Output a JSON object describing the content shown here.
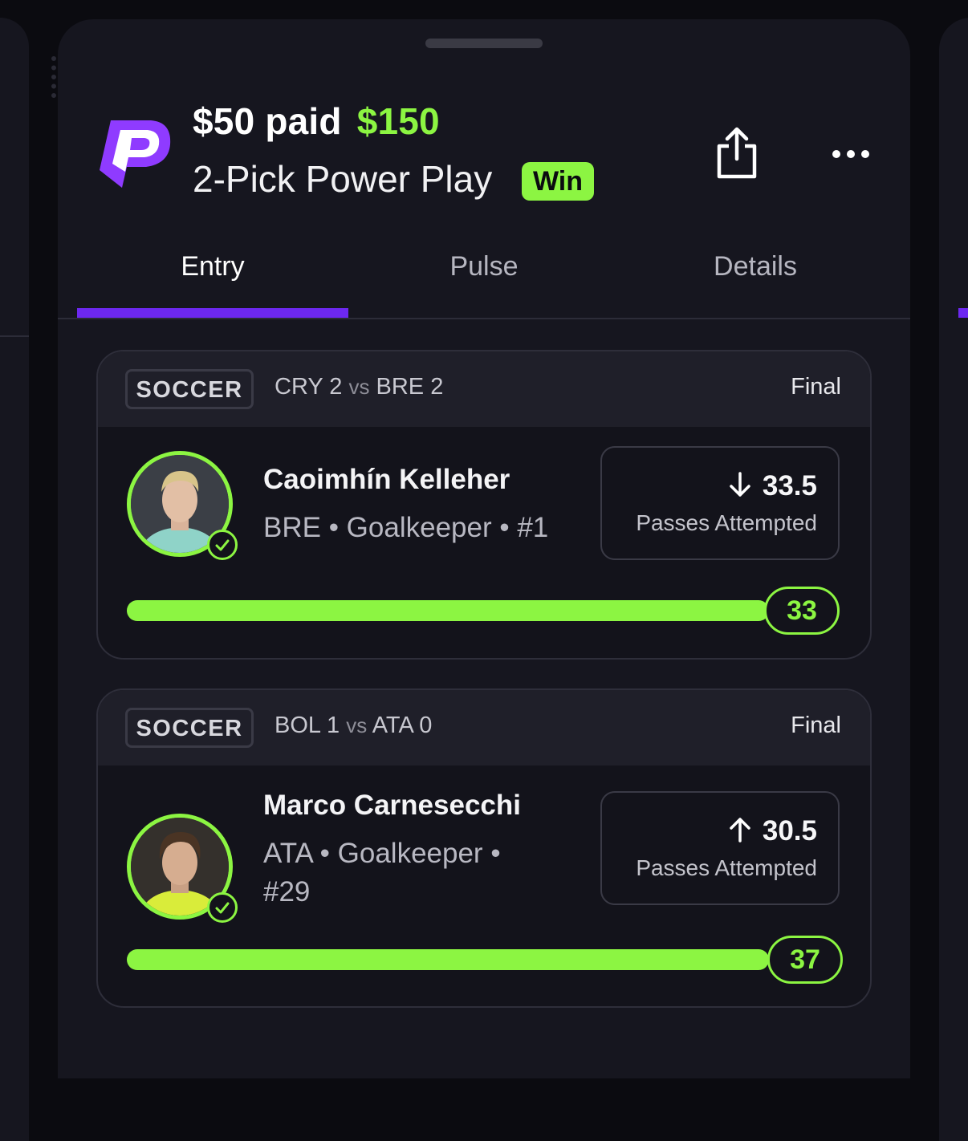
{
  "entry": {
    "paid_label": "$50 paid",
    "payout_label": "$150",
    "play_type": "2-Pick Power Play",
    "result_badge": "Win"
  },
  "actions": {
    "share_icon": "share-icon",
    "more_icon": "more-horizontal-icon"
  },
  "tabs": [
    {
      "label": "Entry",
      "active": true
    },
    {
      "label": "Pulse",
      "active": false
    },
    {
      "label": "Details",
      "active": false
    }
  ],
  "picks": [
    {
      "sport": "SOCCER",
      "home_team": "CRY",
      "home_score": "2",
      "vs": "vs",
      "away_team": "BRE",
      "away_score": "2",
      "status": "Final",
      "player_name": "Caoimhín Kelleher",
      "player_meta": "BRE • Goalkeeper • #1",
      "direction": "down",
      "direction_icon": "arrow-down-icon",
      "line": "33.5",
      "stat": "Passes Attempted",
      "result_value": "33",
      "progress": 1.0
    },
    {
      "sport": "SOCCER",
      "home_team": "BOL",
      "home_score": "1",
      "vs": "vs",
      "away_team": "ATA",
      "away_score": "0",
      "status": "Final",
      "player_name": "Marco Carnesecchi",
      "player_meta": "ATA • Goalkeeper • #29",
      "direction": "up",
      "direction_icon": "arrow-up-icon",
      "line": "30.5",
      "stat": "Passes Attempted",
      "result_value": "37",
      "progress": 1.0
    }
  ],
  "colors": {
    "accent_green": "#8cf542",
    "brand_purple": "#6d28f0",
    "sheet_bg": "#16161f"
  }
}
